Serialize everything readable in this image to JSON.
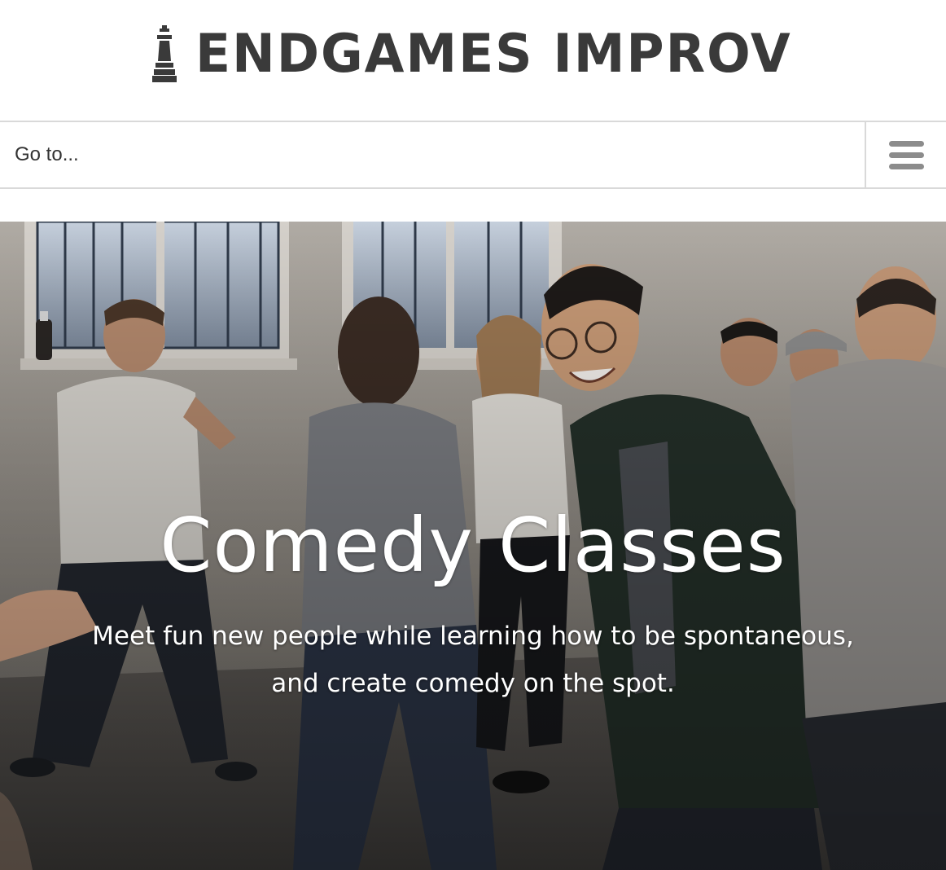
{
  "header": {
    "logo_text": "ENDGAMES IMPROV",
    "logo_icon": "chess-king-icon",
    "logo_color": "#3a3a3a"
  },
  "nav": {
    "select_placeholder": "Go to...",
    "menu_icon": "hamburger-menu-icon",
    "border_color": "#d9d9d9",
    "icon_color": "#8c8c8c"
  },
  "hero": {
    "title": "Comedy Classes",
    "subtitle": "Meet fun new people while learning how to be spontaneous, and create comedy on the spot.",
    "text_color": "#ffffff"
  }
}
